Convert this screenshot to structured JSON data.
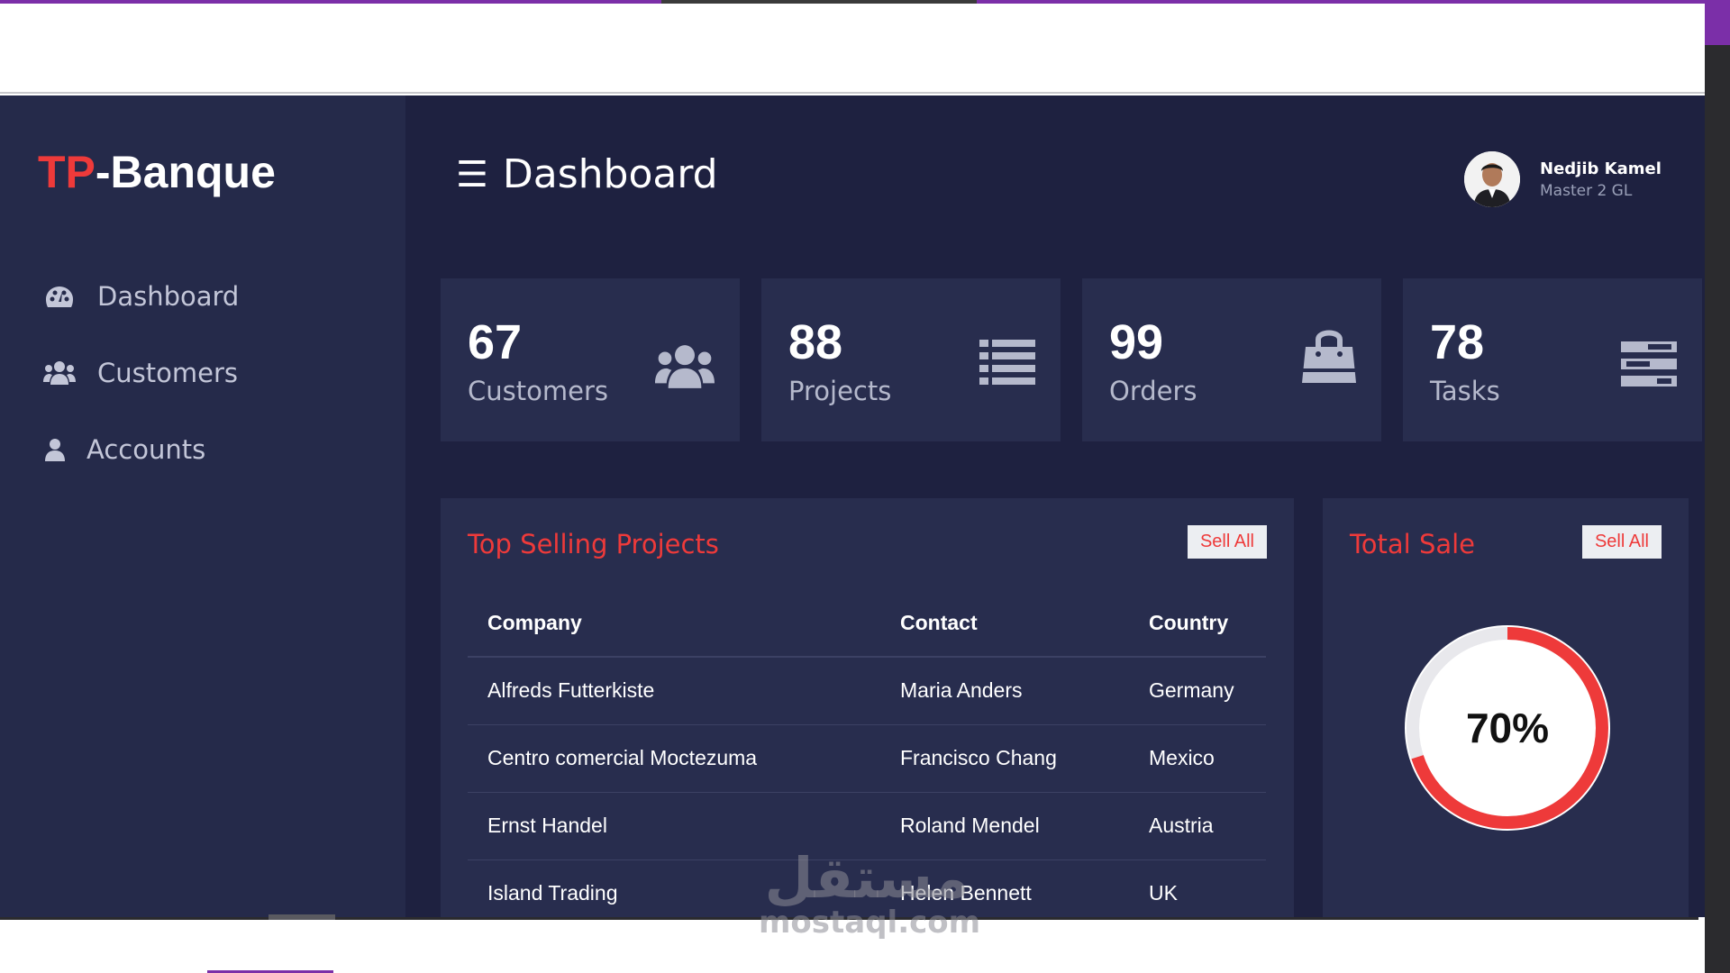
{
  "brand": {
    "prefix": "TP",
    "suffix": "-Banque"
  },
  "sidebar": {
    "items": [
      {
        "label": "Dashboard",
        "icon": "palette-icon"
      },
      {
        "label": "Customers",
        "icon": "users-icon"
      },
      {
        "label": "Accounts",
        "icon": "user-icon"
      }
    ]
  },
  "header": {
    "title": "Dashboard",
    "menu_icon": "☰"
  },
  "user": {
    "name": "Nedjib Kamel",
    "role": "Master 2 GL"
  },
  "stats": [
    {
      "value": "67",
      "label": "Customers",
      "icon": "users-icon"
    },
    {
      "value": "88",
      "label": "Projects",
      "icon": "list-icon"
    },
    {
      "value": "99",
      "label": "Orders",
      "icon": "shopping-bag-icon"
    },
    {
      "value": "78",
      "label": "Tasks",
      "icon": "tasks-icon"
    }
  ],
  "top_selling": {
    "title": "Top Selling Projects",
    "button": "Sell All",
    "columns": [
      "Company",
      "Contact",
      "Country"
    ],
    "rows": [
      [
        "Alfreds Futterkiste",
        "Maria Anders",
        "Germany"
      ],
      [
        "Centro comercial Moctezuma",
        "Francisco Chang",
        "Mexico"
      ],
      [
        "Ernst Handel",
        "Roland Mendel",
        "Austria"
      ],
      [
        "Island Trading",
        "Helen Bennett",
        "UK"
      ]
    ]
  },
  "total_sale": {
    "title": "Total Sale",
    "button": "Sell All",
    "percent_label": "70%",
    "percent": 70
  },
  "watermark": {
    "arabic": "مستقل",
    "latin": "mostaql.com"
  },
  "colors": {
    "accent": "#ee3a3a",
    "background": "#1e2140",
    "panel": "#282d4e",
    "sidebar": "#252a4a"
  }
}
